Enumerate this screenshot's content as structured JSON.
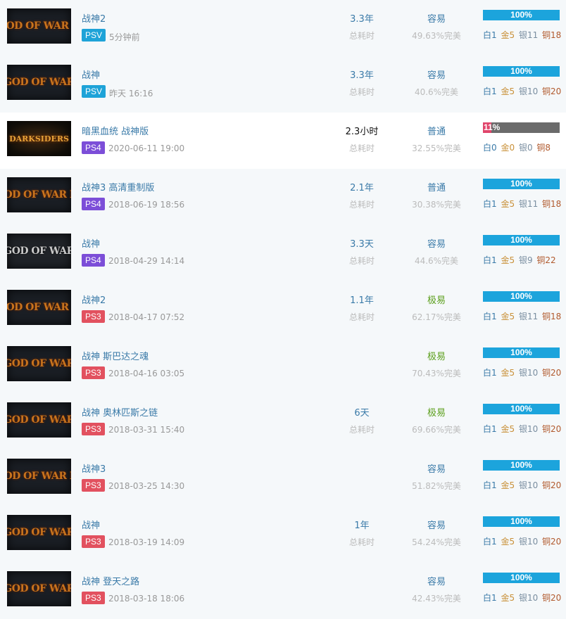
{
  "labels": {
    "duration": "总耗时",
    "completion_suffix": "完美"
  },
  "colors": {
    "psv": "#1ea3d8",
    "ps4": "#7c4ed8",
    "ps3": "#e2515f",
    "progress_full": "#1ca4dc",
    "progress_partial": "#e0456b",
    "link": "#3a7aa8",
    "very_easy": "#5a9e1a"
  },
  "games": [
    {
      "title": "战神2",
      "cover": "GOD OF WAR II",
      "platform": "PSV",
      "time": "5分钟前",
      "duration": "3.3年",
      "show_dur_label": true,
      "difficulty": "容易",
      "diff_class": "c-easy",
      "completion": "49.63%完美",
      "progress": 1.0,
      "progress_text": "100%",
      "trophies": {
        "platinum": "白1",
        "gold": "金5",
        "silver": "银11",
        "bronze": "铜18"
      }
    },
    {
      "title": "战神",
      "cover": "GOD OF WAR",
      "platform": "PSV",
      "time": "昨天 16:16",
      "duration": "3.3年",
      "show_dur_label": true,
      "difficulty": "容易",
      "diff_class": "c-easy",
      "completion": "40.6%完美",
      "progress": 1.0,
      "progress_text": "100%",
      "trophies": {
        "platinum": "白1",
        "gold": "金5",
        "silver": "银10",
        "bronze": "铜20"
      }
    },
    {
      "title": "暗黑血统 战神版",
      "cover": "DARKSIDERS",
      "platform": "PS4",
      "time": "2020-06-11 19:00",
      "duration": "2.3小时",
      "show_dur_label": true,
      "difficulty": "普通",
      "diff_class": "c-normal",
      "completion": "32.55%完美",
      "progress": 0.11,
      "progress_text": "11%",
      "trophies": {
        "platinum": "白0",
        "gold": "金0",
        "silver": "银0",
        "bronze": "铜8"
      }
    },
    {
      "title": "战神3 高清重制版",
      "cover": "GOD OF WAR III",
      "platform": "PS4",
      "time": "2018-06-19 18:56",
      "duration": "2.1年",
      "show_dur_label": true,
      "difficulty": "普通",
      "diff_class": "c-normal",
      "completion": "30.38%完美",
      "progress": 1.0,
      "progress_text": "100%",
      "trophies": {
        "platinum": "白1",
        "gold": "金5",
        "silver": "银11",
        "bronze": "铜18"
      }
    },
    {
      "title": "战神",
      "cover": "GOD OF WAR",
      "platform": "PS4",
      "time": "2018-04-29 14:14",
      "duration": "3.3天",
      "show_dur_label": true,
      "difficulty": "容易",
      "diff_class": "c-easy",
      "completion": "44.6%完美",
      "progress": 1.0,
      "progress_text": "100%",
      "trophies": {
        "platinum": "白1",
        "gold": "金5",
        "silver": "银9",
        "bronze": "铜22"
      }
    },
    {
      "title": "战神2",
      "cover": "GOD OF WAR II",
      "platform": "PS3",
      "time": "2018-04-17 07:52",
      "duration": "1.1年",
      "show_dur_label": true,
      "difficulty": "极易",
      "diff_class": "c-vez",
      "completion": "62.17%完美",
      "progress": 1.0,
      "progress_text": "100%",
      "trophies": {
        "platinum": "白1",
        "gold": "金5",
        "silver": "银11",
        "bronze": "铜18"
      }
    },
    {
      "title": "战神 斯巴达之魂",
      "cover": "GOD OF WAR",
      "platform": "PS3",
      "time": "2018-04-16 03:05",
      "duration": "",
      "show_dur_label": false,
      "difficulty": "极易",
      "diff_class": "c-vez",
      "completion": "70.43%完美",
      "progress": 1.0,
      "progress_text": "100%",
      "trophies": {
        "platinum": "白1",
        "gold": "金5",
        "silver": "银10",
        "bronze": "铜20"
      }
    },
    {
      "title": "战神 奥林匹斯之链",
      "cover": "GOD OF WAR",
      "platform": "PS3",
      "time": "2018-03-31 15:40",
      "duration": "6天",
      "show_dur_label": true,
      "difficulty": "极易",
      "diff_class": "c-vez",
      "completion": "69.66%完美",
      "progress": 1.0,
      "progress_text": "100%",
      "trophies": {
        "platinum": "白1",
        "gold": "金5",
        "silver": "银10",
        "bronze": "铜20"
      }
    },
    {
      "title": "战神3",
      "cover": "GOD OF WAR III",
      "platform": "PS3",
      "time": "2018-03-25 14:30",
      "duration": "",
      "show_dur_label": false,
      "difficulty": "容易",
      "diff_class": "c-easy",
      "completion": "51.82%完美",
      "progress": 1.0,
      "progress_text": "100%",
      "trophies": {
        "platinum": "白1",
        "gold": "金5",
        "silver": "银10",
        "bronze": "铜20"
      }
    },
    {
      "title": "战神",
      "cover": "GOD OF WAR",
      "platform": "PS3",
      "time": "2018-03-19 14:09",
      "duration": "1年",
      "show_dur_label": true,
      "difficulty": "容易",
      "diff_class": "c-easy",
      "completion": "54.24%完美",
      "progress": 1.0,
      "progress_text": "100%",
      "trophies": {
        "platinum": "白1",
        "gold": "金5",
        "silver": "银10",
        "bronze": "铜20"
      }
    },
    {
      "title": "战神 登天之路",
      "cover": "GOD OF WAR",
      "platform": "PS3",
      "time": "2018-03-18 18:06",
      "duration": "",
      "show_dur_label": false,
      "difficulty": "容易",
      "diff_class": "c-easy",
      "completion": "42.43%完美",
      "progress": 1.0,
      "progress_text": "100%",
      "trophies": {
        "platinum": "白1",
        "gold": "金5",
        "silver": "银10",
        "bronze": "铜20"
      }
    }
  ]
}
